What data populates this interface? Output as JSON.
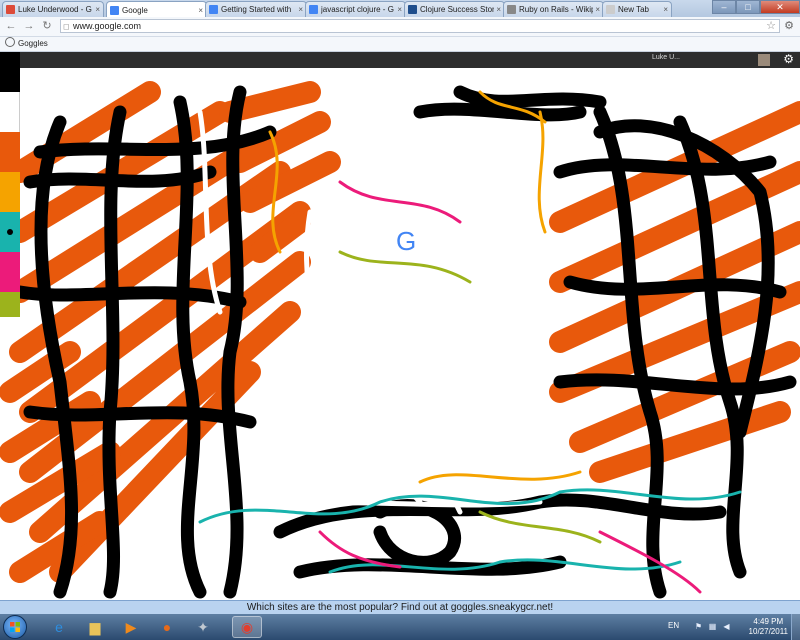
{
  "browser": {
    "tabs": [
      {
        "title": "Luke Underwood - G",
        "icon": "google-plus-icon",
        "color": "#dd4b39"
      },
      {
        "title": "Google",
        "icon": "google-icon",
        "color": "#4285f4"
      },
      {
        "title": "Getting Started with",
        "icon": "google-icon",
        "color": "#4285f4"
      },
      {
        "title": "javascript clojure - G",
        "icon": "google-icon",
        "color": "#4285f4"
      },
      {
        "title": "Clojure Success Stor",
        "icon": "clojure-icon",
        "color": "#1f4e8c"
      },
      {
        "title": "Ruby on Rails - Wikip",
        "icon": "wikipedia-icon",
        "color": "#888888"
      },
      {
        "title": "New Tab",
        "icon": "page-icon",
        "color": "#cccccc"
      }
    ],
    "active_tab_index": 1,
    "url": "www.google.com",
    "bookmark": "Goggles"
  },
  "google_bar": {
    "signin_text": "Luke U..."
  },
  "palette": {
    "colors": [
      "#000000",
      "#ffffff",
      "#e8590c",
      "#f5a300",
      "#19b3ad",
      "#ec1b7a",
      "#9cb31c"
    ],
    "selected_index": 4
  },
  "status_bar": {
    "text": "Which sites are the most popular? Find out at goggles.sneakygcr.net!"
  },
  "taskbar": {
    "apps": [
      {
        "name": "internet-explorer-icon",
        "glyph": "e",
        "color": "#2d8ee0",
        "active": false
      },
      {
        "name": "explorer-folder-icon",
        "glyph": "▆",
        "color": "#e8c35a",
        "active": false
      },
      {
        "name": "media-player-icon",
        "glyph": "▶",
        "color": "#f08a1c",
        "active": false
      },
      {
        "name": "firefox-icon",
        "glyph": "●",
        "color": "#e66a1a",
        "active": false
      },
      {
        "name": "app-icon",
        "glyph": "✦",
        "color": "#c0c8d0",
        "active": false
      },
      {
        "name": "chrome-icon",
        "glyph": "◉",
        "color": "#e23d2d",
        "active": true
      }
    ],
    "language": "EN",
    "time": "4:49 PM",
    "date": "10/27/2011"
  }
}
